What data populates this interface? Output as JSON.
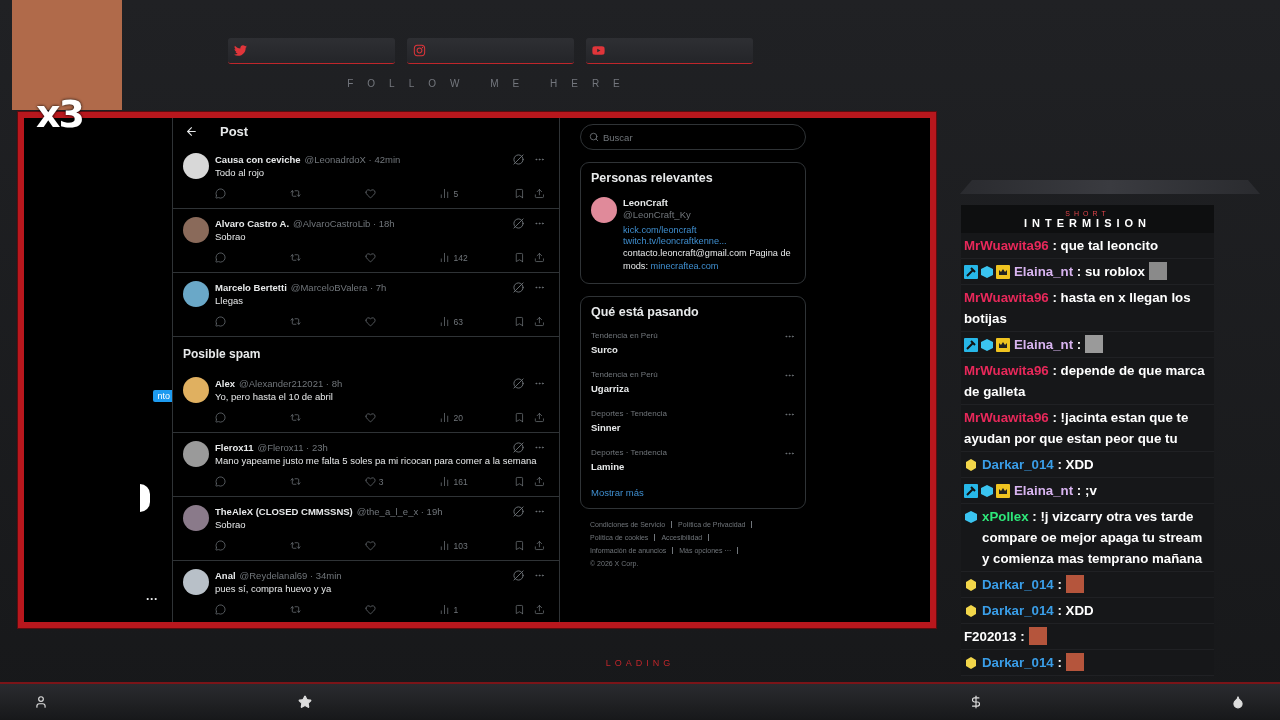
{
  "overlay": {
    "photo_caption": "x3",
    "social_links": [
      {
        "kind": "twitter"
      },
      {
        "kind": "instagram"
      },
      {
        "kind": "youtube"
      }
    ],
    "follow_label": "FOLLOW ME HERE",
    "loading_label": "LOADING"
  },
  "sidebar": {
    "badge": "nto",
    "more": "···"
  },
  "feed": {
    "title": "Post",
    "posts": [
      {
        "name": "Causa con ceviche",
        "meta": "@LeonadrdoX · 42min",
        "text": "Todo al rojo",
        "views": "5"
      },
      {
        "name": "Alvaro Castro A.",
        "meta": "@AlvaroCastroLib · 18h",
        "text": "Sobrao",
        "views": "142"
      },
      {
        "name": "Marcelo Bertetti",
        "meta": "@MarceloBValera · 7h",
        "text": "Llegas",
        "views": "63"
      }
    ],
    "spam_heading": "Posible spam",
    "spam_posts": [
      {
        "name": "Alex",
        "meta": "@Alexander212021 · 8h",
        "text": "Yo, pero hasta el 10 de abril",
        "views": "20"
      },
      {
        "name": "Flerox11",
        "meta": "@Flerox11 · 23h",
        "text": "Mano yapeame justo me falta 5 soles pa mi ricocan para comer a la semana",
        "likes": "3",
        "views": "161"
      },
      {
        "name": "TheAleX (CLOSED CMMSSNS)",
        "meta": "@the_a_l_e_x · 19h",
        "text": "Sobrao",
        "views": "103"
      },
      {
        "name": "Anal",
        "meta": "@Reydelanal69 · 34min",
        "text": "pues sí, compra huevo y ya",
        "views": "1"
      }
    ]
  },
  "search": {
    "placeholder": "Buscar"
  },
  "relevant": {
    "title": "Personas relevantes",
    "name": "LeonCraft",
    "handle": "@LeonCraft_Ky",
    "links": [
      "kick.com/leoncraft",
      "twitch.tv/leoncraftkenne..."
    ],
    "bio": "contacto.leoncraft@gmail.com Pagina de mods:",
    "bio_link": "minecraftea.com"
  },
  "trends": {
    "title": "Qué está pasando",
    "items": [
      {
        "context": "Tendencia en Perú",
        "topic": "Surco"
      },
      {
        "context": "Tendencia en Perú",
        "topic": "Ugarriza"
      },
      {
        "context": "Deportes · Tendencia",
        "topic": "Sinner"
      },
      {
        "context": "Deportes · Tendencia",
        "topic": "Lamine"
      }
    ],
    "more": "Mostrar más"
  },
  "footer": {
    "links": [
      [
        "Condiciones de Servicio",
        "Política de Privacidad"
      ],
      [
        "Política de cookies",
        "Accesibilidad"
      ],
      [
        "Información de anuncios",
        "Más opciones ···"
      ]
    ],
    "copyright": "© 2026 X Corp."
  },
  "chat": {
    "header_top": "SHORT",
    "header": "INTERMISION",
    "messages": [
      {
        "user": "MrWuawita96",
        "color": "#e8285a",
        "text": ": que tal leoncito"
      },
      {
        "user": "Elaina_nt",
        "color": "#d8b4f0",
        "badges": [
          {
            "kind": "mod"
          },
          {
            "kind": "gem"
          },
          {
            "kind": "crown"
          }
        ],
        "text": ": su roblox",
        "emote": {
          "kind": "figure"
        }
      },
      {
        "user": "MrWuawita96",
        "color": "#e8285a",
        "text": ": hasta en x llegan los botijas"
      },
      {
        "user": "Elaina_nt",
        "color": "#d8b4f0",
        "badges": [
          {
            "kind": "mod"
          },
          {
            "kind": "gem"
          },
          {
            "kind": "crown"
          }
        ],
        "text": ":",
        "emote": {
          "kind": "animal"
        }
      },
      {
        "user": "MrWuawita96",
        "color": "#e8285a",
        "text": ": depende de que marca de galleta"
      },
      {
        "user": "MrWuawita96",
        "color": "#e8285a",
        "text": ": !jacinta estan que te ayudan por que estan peor que tu"
      },
      {
        "user": "Darkar_014",
        "color": "#3a9ee8",
        "badges": [
          {
            "kind": "bits"
          }
        ],
        "text": ": XDD"
      },
      {
        "user": "Elaina_nt",
        "color": "#d8b4f0",
        "badges": [
          {
            "kind": "mod"
          },
          {
            "kind": "gem"
          },
          {
            "kind": "crown"
          }
        ],
        "text": ": ;v"
      },
      {
        "user": "xPollex",
        "color": "#2ee87a",
        "badges": [
          {
            "kind": "gem"
          }
        ],
        "text": ": !j vizcarry otra ves tarde compare oe mejor apaga tu stream y comienza mas temprano mañana"
      },
      {
        "user": "Darkar_014",
        "color": "#3a9ee8",
        "badges": [
          {
            "kind": "bits"
          }
        ],
        "text": ":",
        "emote": {
          "kind": "photo"
        }
      },
      {
        "user": "Darkar_014",
        "color": "#3a9ee8",
        "badges": [
          {
            "kind": "bits"
          }
        ],
        "text": ": XDD"
      },
      {
        "user": "F202013",
        "color": "#ffffff",
        "text": ":",
        "emote": {
          "kind": "photo"
        }
      },
      {
        "user": "Darkar_014",
        "color": "#3a9ee8",
        "badges": [
          {
            "kind": "bits"
          }
        ],
        "text": ":",
        "emote": {
          "kind": "photo"
        }
      }
    ]
  }
}
